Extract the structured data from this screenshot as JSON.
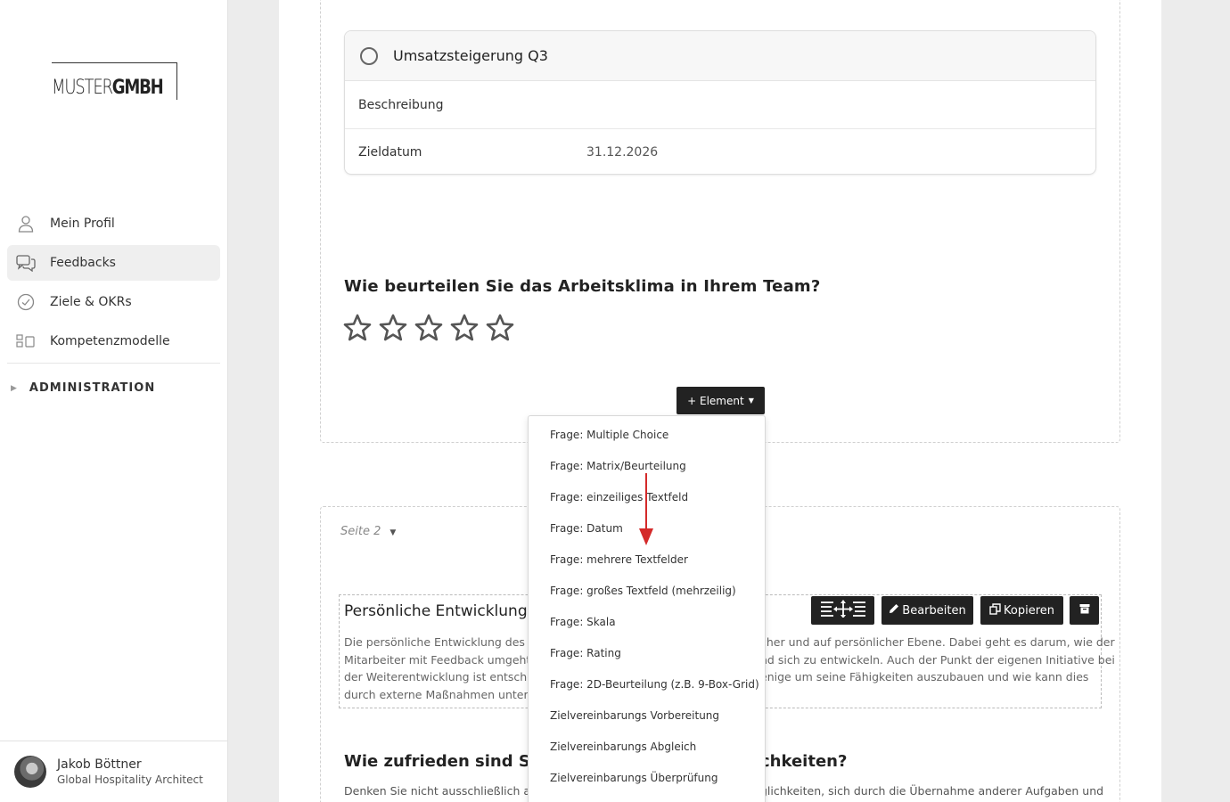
{
  "sidebar": {
    "logo": {
      "light": "MUSTER",
      "bold": "GMBH"
    },
    "nav": [
      {
        "label": "Mein Profil",
        "icon": "user-icon"
      },
      {
        "label": "Feedbacks",
        "icon": "chat-icon",
        "active": true
      },
      {
        "label": "Ziele & OKRs",
        "icon": "check-circle-icon"
      },
      {
        "label": "Kompetenzmodelle",
        "icon": "grid-icon"
      }
    ],
    "admin_label": "ADMINISTRATION",
    "user": {
      "name": "Jakob Böttner",
      "role": "Global Hospitality Architect"
    }
  },
  "goal_card": {
    "title": "Umsatzsteigerung Q3",
    "description_label": "Beschreibung",
    "date_label": "Zieldatum",
    "date_value": "31.12.2026"
  },
  "question1": {
    "title": "Wie beurteilen Sie das Arbeitsklima in Ihrem Team?",
    "rating": 0,
    "max_stars": 5
  },
  "element_button": {
    "label": "+ Element"
  },
  "element_menu": [
    "Frage: Multiple Choice",
    "Frage: Matrix/Beurteilung",
    "Frage: einzeiliges Textfeld",
    "Frage: Datum",
    "Frage: mehrere Textfelder",
    "Frage: großes Textfeld (mehrzeilig)",
    "Frage: Skala",
    "Frage: Rating",
    "Frage: 2D-Beurteilung (z.B. 9-Box-Grid)",
    "Zielvereinbarungs Vorbereitung",
    "Zielvereinbarungs Abgleich",
    "Zielvereinbarungs Überprüfung"
  ],
  "page2": {
    "selector_label": "Seite 2",
    "section_title": "Persönliche Entwicklung",
    "section_text_lines": [
      {
        "start": "Die persönliche Entwicklung des Mi",
        "end": "cher und auf persönlicher Ebene. Dabei geht es darum, wie der"
      },
      {
        "start": "Mitarbeiter mit Feedback umgeht u",
        "end": "nd sich zu entwickeln. Auch der Punkt der eigenen Initiative bei"
      },
      {
        "start": "der Weiterentwicklung ist entschei",
        "end": "enige um seine Fähigkeiten auszubauen und wie kann dies"
      },
      {
        "start": "durch externe Maßnahmen unters",
        "end": ""
      }
    ],
    "buttons": {
      "edit": "Bearbeiten",
      "copy": "Kopieren"
    },
    "question2": {
      "title_start": "Wie zufrieden sind Sie",
      "title_end": "chkeiten?"
    },
    "question2_text": {
      "start": "Denken Sie nicht ausschließlich an Tr",
      "end": "glichkeiten, sich durch die Übernahme anderer Aufgaben und"
    }
  },
  "colors": {
    "accent_dark": "#222222",
    "arrow": "#d42a2a",
    "active_nav": "#efefef"
  }
}
